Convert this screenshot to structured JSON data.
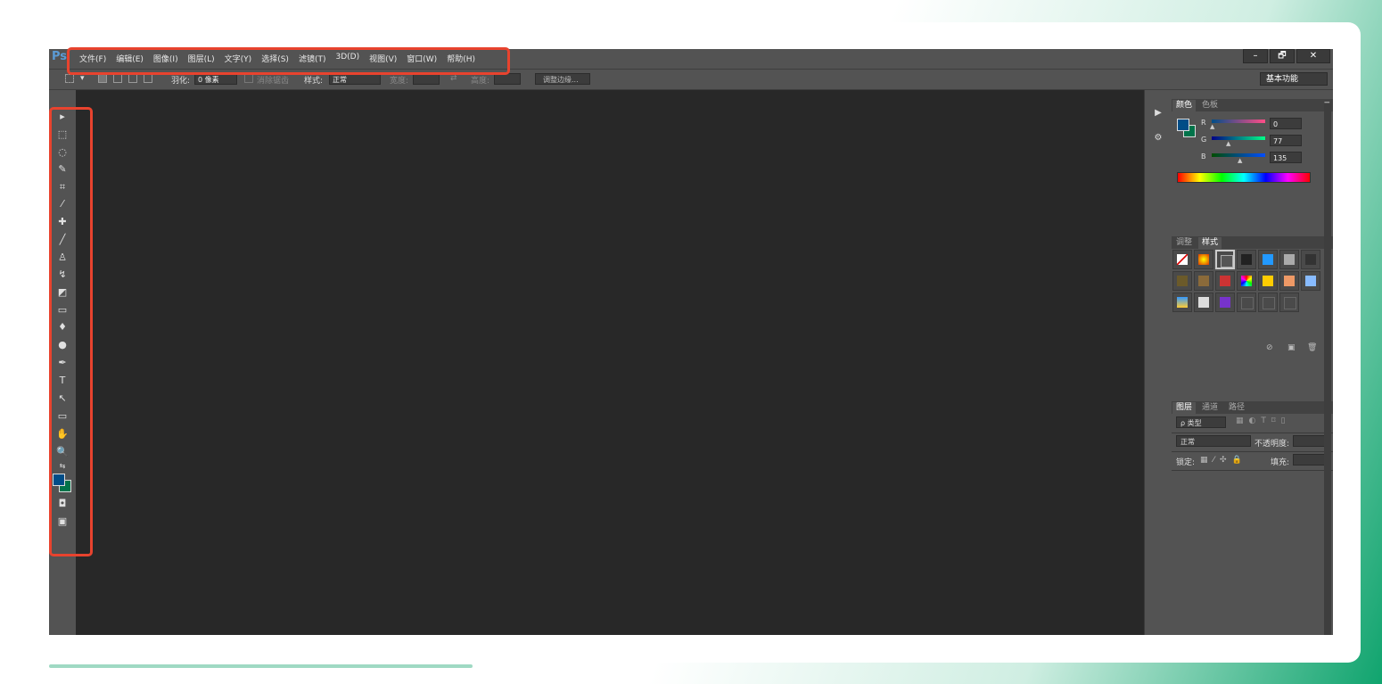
{
  "app": {
    "logo": "Ps"
  },
  "menu": [
    "文件(F)",
    "编辑(E)",
    "图像(I)",
    "图层(L)",
    "文字(Y)",
    "选择(S)",
    "滤镜(T)",
    "3D(D)",
    "视图(V)",
    "窗口(W)",
    "帮助(H)"
  ],
  "window_controls": {
    "minimize": "–",
    "restore": "🗗",
    "close": "✕"
  },
  "options": {
    "feather_label": "羽化:",
    "feather_value": "0 像素",
    "antialias_label": "消除锯齿",
    "style_label": "样式:",
    "style_value": "正常",
    "width_label": "宽度:",
    "height_label": "高度:",
    "refine_edge": "调整边缘...",
    "workspace": "基本功能"
  },
  "color_panel": {
    "tabs": [
      "颜色",
      "色板"
    ],
    "channels": [
      {
        "label": "R",
        "value": "0"
      },
      {
        "label": "G",
        "value": "77"
      },
      {
        "label": "B",
        "value": "135"
      }
    ],
    "foreground": "#004d87",
    "background": "#00734a"
  },
  "styles_panel": {
    "tabs": [
      "调整",
      "样式"
    ]
  },
  "layers_panel": {
    "tabs": [
      "图层",
      "通道",
      "路径"
    ],
    "filter_label": "ρ 类型",
    "blend_mode": "正常",
    "opacity_label": "不透明度:",
    "lock_label": "锁定:",
    "fill_label": "填充:"
  },
  "colors": {
    "highlight": "#e8432e",
    "canvas": "#282828",
    "ui": "#535353"
  }
}
